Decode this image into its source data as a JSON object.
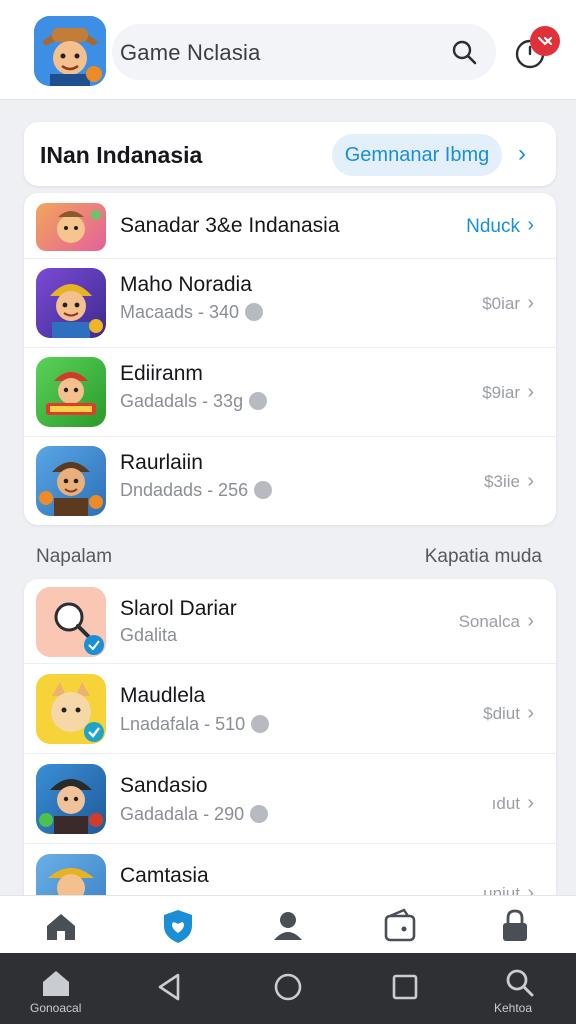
{
  "header": {
    "search_text": "Game Nclasia",
    "logo_icon": "cartoon-explorer-app-icon",
    "notification_icon": "bell-icon"
  },
  "featured": {
    "title": "INan Indanasia",
    "pill_label": "Gemnanar Ibmg",
    "head_chevron": "›",
    "rows": [
      {
        "title": "Sanadar 3&e Indanasia",
        "subtitle": "",
        "right": "Nduck",
        "icon": "game-icon-orange"
      },
      {
        "title": "Maho Noradia",
        "subtitle": "Macaads - 340",
        "right": "$0iar",
        "icon": "game-icon-purple"
      },
      {
        "title": "Ediiranm",
        "subtitle": "Gadadals - 33g",
        "right": "$9iar",
        "icon": "game-icon-green"
      },
      {
        "title": "Raurlaiin",
        "subtitle": "Dndadads - 256",
        "right": "$3iie",
        "icon": "game-icon-blue"
      }
    ]
  },
  "section": {
    "left_label": "Napalam",
    "right_label": "Kapatia muda",
    "rows": [
      {
        "title": "Slarol Dariar",
        "subtitle": "Gdalita",
        "right": "Sonalca",
        "icon": "game-icon-peach"
      },
      {
        "title": "Maudlela",
        "subtitle": "Lnadafala - 510",
        "right": "$diut",
        "icon": "game-icon-yellow"
      },
      {
        "title": "Sandasio",
        "subtitle": "Gadadala - 290",
        "right": "ıdut",
        "icon": "game-icon-dark"
      },
      {
        "title": "Camtasia",
        "subtitle": "",
        "right": "uniut",
        "icon": "game-icon-gold"
      }
    ]
  },
  "tabbar": {
    "tabs": [
      "home-icon",
      "shield-heart-icon",
      "profile-icon",
      "wallet-icon",
      "lock-icon"
    ],
    "active_index": 1
  },
  "sysnav": {
    "left_label": "Gonoacal",
    "right_label": "Kehtoa"
  },
  "colors": {
    "accent": "#1a8fd6",
    "badge": "#e0303a",
    "nav_bg": "#2e3034"
  }
}
